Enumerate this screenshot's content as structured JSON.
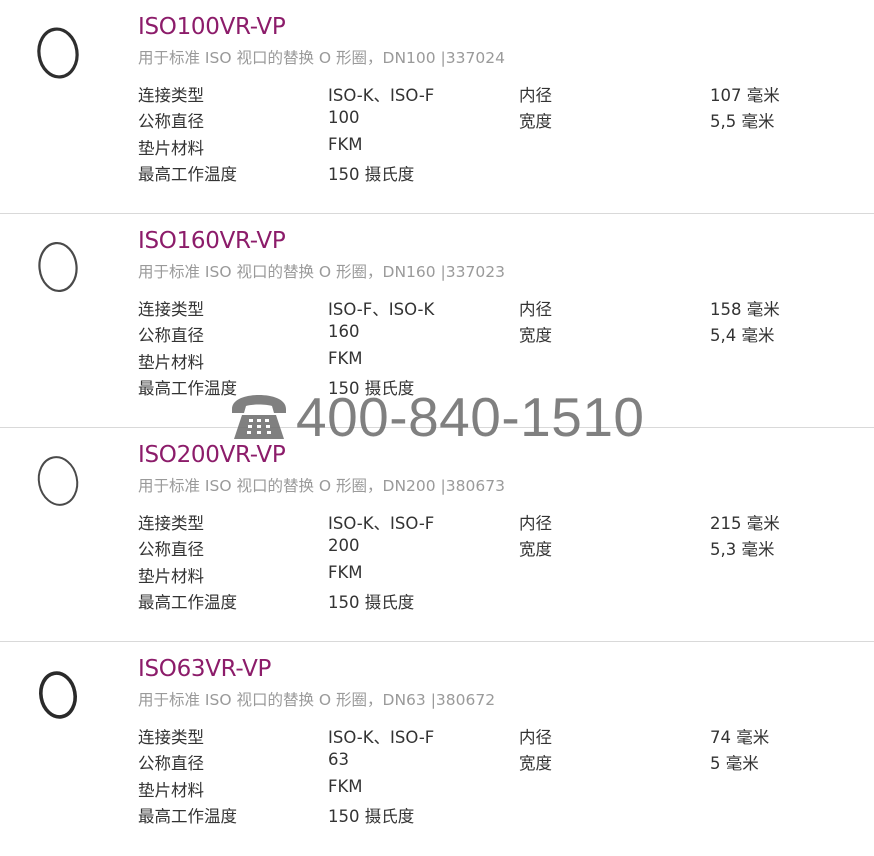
{
  "products": [
    {
      "title": "ISO100VR-VP",
      "subtitle": "用于标准 ISO 视口的替换 O 形圈，DN100 |337024",
      "specs": [
        {
          "label1": "连接类型",
          "value1": "ISO-K、ISO-F",
          "label2": "内径",
          "value2": "107 毫米"
        },
        {
          "label1": "公称直径",
          "value1": "100",
          "label2": "宽度",
          "value2": "5,5 毫米"
        },
        {
          "label1": "垫片材料",
          "value1": "FKM",
          "label2": "",
          "value2": ""
        },
        {
          "label1": "最高工作温度",
          "value1": "150 摄氏度",
          "label2": "",
          "value2": ""
        }
      ]
    },
    {
      "title": "ISO160VR-VP",
      "subtitle": "用于标准 ISO 视口的替换 O 形圈，DN160 |337023",
      "specs": [
        {
          "label1": "连接类型",
          "value1": "ISO-F、ISO-K",
          "label2": "内径",
          "value2": "158 毫米"
        },
        {
          "label1": "公称直径",
          "value1": "160",
          "label2": "宽度",
          "value2": "5,4 毫米"
        },
        {
          "label1": "垫片材料",
          "value1": "FKM",
          "label2": "",
          "value2": ""
        },
        {
          "label1": "最高工作温度",
          "value1": "150 摄氏度",
          "label2": "",
          "value2": ""
        }
      ]
    },
    {
      "title": "ISO200VR-VP",
      "subtitle": "用于标准 ISO 视口的替换 O 形圈，DN200 |380673",
      "specs": [
        {
          "label1": "连接类型",
          "value1": "ISO-K、ISO-F",
          "label2": "内径",
          "value2": "215 毫米"
        },
        {
          "label1": "公称直径",
          "value1": "200",
          "label2": "宽度",
          "value2": "5,3 毫米"
        },
        {
          "label1": "垫片材料",
          "value1": "FKM",
          "label2": "",
          "value2": ""
        },
        {
          "label1": "最高工作温度",
          "value1": "150 摄氏度",
          "label2": "",
          "value2": ""
        }
      ]
    },
    {
      "title": "ISO63VR-VP",
      "subtitle": "用于标准 ISO 视口的替换 O 形圈，DN63 |380672",
      "specs": [
        {
          "label1": "连接类型",
          "value1": "ISO-K、ISO-F",
          "label2": "内径",
          "value2": "74 毫米"
        },
        {
          "label1": "公称直径",
          "value1": "63",
          "label2": "宽度",
          "value2": "5 毫米"
        },
        {
          "label1": "垫片材料",
          "value1": "FKM",
          "label2": "",
          "value2": ""
        },
        {
          "label1": "最高工作温度",
          "value1": "150 摄氏度",
          "label2": "",
          "value2": ""
        }
      ]
    }
  ],
  "watermark": {
    "icon": "telephone-icon",
    "phone": "400-840-1510"
  },
  "colors": {
    "title": "#8c1c6a",
    "subtitle": "#9a9a9a",
    "text": "#333333",
    "divider": "#d9d9d9",
    "watermark": "#6f6f6f"
  }
}
